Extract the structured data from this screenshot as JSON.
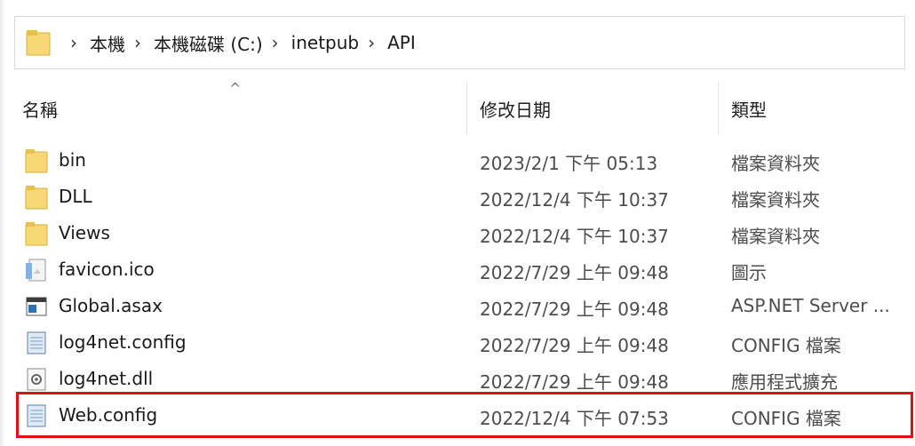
{
  "address_bar": {
    "crumbs": [
      "本機",
      "本機磁碟 (C:)",
      "inetpub",
      "API"
    ],
    "separator": "›"
  },
  "columns": {
    "name": "名稱",
    "modified": "修改日期",
    "type": "類型",
    "sort_indicator": "^"
  },
  "files": [
    {
      "name": "bin",
      "modified": "2023/2/1 下午 05:13",
      "type": "檔案資料夾",
      "icon": "folder-icon"
    },
    {
      "name": "DLL",
      "modified": "2022/12/4 下午 10:37",
      "type": "檔案資料夾",
      "icon": "folder-icon"
    },
    {
      "name": "Views",
      "modified": "2022/12/4 下午 10:37",
      "type": "檔案資料夾",
      "icon": "folder-icon"
    },
    {
      "name": "favicon.ico",
      "modified": "2022/7/29 上午 09:48",
      "type": "圖示",
      "icon": "image-file-icon"
    },
    {
      "name": "Global.asax",
      "modified": "2022/7/29 上午 09:48",
      "type": "ASP.NET Server ...",
      "icon": "aspnet-file-icon"
    },
    {
      "name": "log4net.config",
      "modified": "2022/7/29 上午 09:48",
      "type": "CONFIG 檔案",
      "icon": "config-file-icon"
    },
    {
      "name": "log4net.dll",
      "modified": "2022/7/29 上午 09:48",
      "type": "應用程式擴充",
      "icon": "dll-file-icon"
    },
    {
      "name": "Web.config",
      "modified": "2022/12/4 下午 07:53",
      "type": "CONFIG 檔案",
      "icon": "config-file-icon"
    }
  ],
  "highlight_color": "#e0101a",
  "folder_color": "#f8d775"
}
